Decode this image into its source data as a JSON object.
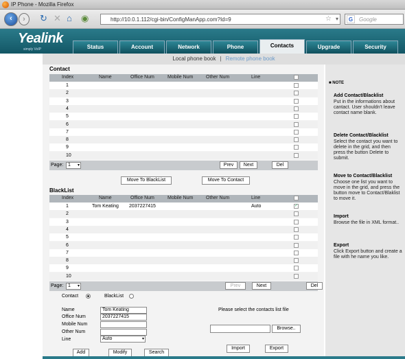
{
  "browser": {
    "title": "IP Phone - Mozilla Firefox",
    "url": "http://10.0.1.112/cgi-bin/ConfigManApp.com?Id=9",
    "search_placeholder": "Google"
  },
  "brand": {
    "logo": "Yealink",
    "tagline": "simply VoIP"
  },
  "tabs": [
    "Status",
    "Account",
    "Network",
    "Phone",
    "Contacts",
    "Upgrade",
    "Security"
  ],
  "active_tab": "Contacts",
  "subnav": {
    "local": "Local phone book",
    "sep": "|",
    "remote": "Remote phone book"
  },
  "contact": {
    "title": "Contact",
    "headers": [
      "Index",
      "Name",
      "Office Num",
      "Mobile Num",
      "Other Num",
      "Line"
    ],
    "rows": [
      {
        "index": "1",
        "name": "",
        "office": "",
        "mobile": "",
        "other": "",
        "line": "",
        "checked": false
      },
      {
        "index": "2",
        "name": "",
        "office": "",
        "mobile": "",
        "other": "",
        "line": "",
        "checked": false
      },
      {
        "index": "3",
        "name": "",
        "office": "",
        "mobile": "",
        "other": "",
        "line": "",
        "checked": false
      },
      {
        "index": "4",
        "name": "",
        "office": "",
        "mobile": "",
        "other": "",
        "line": "",
        "checked": false
      },
      {
        "index": "5",
        "name": "",
        "office": "",
        "mobile": "",
        "other": "",
        "line": "",
        "checked": false
      },
      {
        "index": "6",
        "name": "",
        "office": "",
        "mobile": "",
        "other": "",
        "line": "",
        "checked": false
      },
      {
        "index": "7",
        "name": "",
        "office": "",
        "mobile": "",
        "other": "",
        "line": "",
        "checked": false
      },
      {
        "index": "8",
        "name": "",
        "office": "",
        "mobile": "",
        "other": "",
        "line": "",
        "checked": false
      },
      {
        "index": "9",
        "name": "",
        "office": "",
        "mobile": "",
        "other": "",
        "line": "",
        "checked": false
      },
      {
        "index": "10",
        "name": "",
        "office": "",
        "mobile": "",
        "other": "",
        "line": "",
        "checked": false
      }
    ],
    "page_label": "Page:",
    "page_value": "1",
    "prev": "Prev",
    "next": "Next",
    "del": "Del"
  },
  "move_buttons": {
    "to_blacklist": "Move To BlackList",
    "to_contact": "Move To Contact"
  },
  "blacklist": {
    "title": "BlackList",
    "headers": [
      "Index",
      "Name",
      "Office Num",
      "Mobile Num",
      "Other Num",
      "Line"
    ],
    "rows": [
      {
        "index": "1",
        "name": "Tom Keating",
        "office": "2037227415",
        "mobile": "",
        "other": "",
        "line": "Auto",
        "checked": true
      },
      {
        "index": "2",
        "name": "",
        "office": "",
        "mobile": "",
        "other": "",
        "line": "",
        "checked": false
      },
      {
        "index": "3",
        "name": "",
        "office": "",
        "mobile": "",
        "other": "",
        "line": "",
        "checked": false
      },
      {
        "index": "4",
        "name": "",
        "office": "",
        "mobile": "",
        "other": "",
        "line": "",
        "checked": false
      },
      {
        "index": "5",
        "name": "",
        "office": "",
        "mobile": "",
        "other": "",
        "line": "",
        "checked": false
      },
      {
        "index": "6",
        "name": "",
        "office": "",
        "mobile": "",
        "other": "",
        "line": "",
        "checked": false
      },
      {
        "index": "7",
        "name": "",
        "office": "",
        "mobile": "",
        "other": "",
        "line": "",
        "checked": false
      },
      {
        "index": "8",
        "name": "",
        "office": "",
        "mobile": "",
        "other": "",
        "line": "",
        "checked": false
      },
      {
        "index": "9",
        "name": "",
        "office": "",
        "mobile": "",
        "other": "",
        "line": "",
        "checked": false
      },
      {
        "index": "10",
        "name": "",
        "office": "",
        "mobile": "",
        "other": "",
        "line": "",
        "checked": false
      }
    ],
    "page_label": "Page:",
    "page_value": "1",
    "prev": "Prev",
    "next": "Next",
    "del": "Del"
  },
  "form": {
    "contact_label": "Contact",
    "blacklist_label": "BlackList",
    "selected": "Contact",
    "name_label": "Name",
    "name_value": "Tom Keating",
    "office_label": "Office Num",
    "office_value": "2037227415",
    "mobile_label": "Mobile Num",
    "mobile_value": "",
    "other_label": "Other Num",
    "other_value": "",
    "line_label": "Line",
    "line_value": "Auto",
    "add": "Add",
    "modify": "Modify",
    "search": "Search"
  },
  "import": {
    "prompt": "Please select the contacts list file",
    "browse": "Browse..",
    "import": "Import",
    "export": "Export"
  },
  "note": {
    "label": "NOTE",
    "sections": [
      {
        "heading": "Add Contact/Blacklist",
        "text": "Put in the informations about cantact. User shouldn't leave contact name blank."
      },
      {
        "heading": "Delete Contact/Blacklist",
        "text": "Select the contact you want to delete in the grid, and then press the button Delete to submit."
      },
      {
        "heading": "Move to Contact/Blacklist",
        "text": "Choose one list you want to move in the grid, and press the button move to Contact/Blaklist to move it."
      },
      {
        "heading": "Import",
        "text": "Browse the file in XML format.."
      },
      {
        "heading": "Export",
        "text": "Click Export button and create a file with he name you like."
      }
    ]
  },
  "colors": {
    "header": "#135766",
    "accent": "#2a7a8a",
    "grid_header": "#b0b6bb"
  }
}
